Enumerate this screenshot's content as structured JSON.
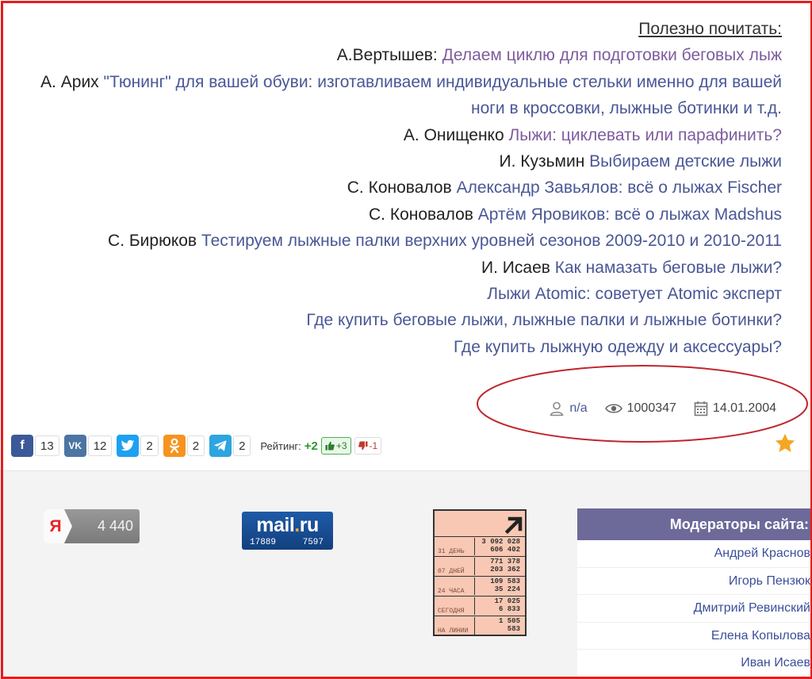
{
  "reading": {
    "header": "Полезно почитать:",
    "items": [
      {
        "author": "А.Вертышев: ",
        "link": "Делаем циклю для подготовки беговых лыж",
        "visited": true
      },
      {
        "author": "А. Арих ",
        "link": "\"Тюнинг\" для вашей обуви: изготавливаем индивидуальные стельки именно для вашей ноги в кроссовки, лыжные ботинки и т.д.",
        "visited": false
      },
      {
        "author": "А. Онищенко ",
        "link": "Лыжи: циклевать или парафинить?",
        "visited": true
      },
      {
        "author": "И. Кузьмин ",
        "link": "Выбираем детские лыжи",
        "visited": false
      },
      {
        "author": "С. Коновалов ",
        "link": "Александр Завьялов: всё о лыжах Fischer",
        "visited": false
      },
      {
        "author": "С. Коновалов ",
        "link": "Артём Яровиков: всё о лыжах Madshus",
        "visited": false
      },
      {
        "author": "С. Бирюков ",
        "link": "Тестируем лыжные палки верхних уровней сезонов 2009-2010 и 2010-2011",
        "visited": false
      },
      {
        "author": "И. Исаев ",
        "link": "Как намазать беговые лыжи?",
        "visited": false
      },
      {
        "author": "",
        "link": "Лыжи Atomic: советует Atomic эксперт",
        "visited": false
      },
      {
        "author": "",
        "link": "Где купить беговые лыжи, лыжные палки и лыжные ботинки?",
        "visited": false
      },
      {
        "author": "",
        "link": "Где купить лыжную одежду и аксессуары?",
        "visited": false
      }
    ]
  },
  "meta": {
    "author": "n/a",
    "views": "1000347",
    "date": "14.01.2004",
    "icons": [
      "user-icon",
      "eye-icon",
      "calendar-icon"
    ]
  },
  "share": {
    "facebook": {
      "label": "f",
      "count": "13",
      "color": "#3b5998"
    },
    "vk": {
      "label": "VK",
      "count": "12",
      "color": "#4c75a3"
    },
    "twitter": {
      "count": "2",
      "color": "#1da1f2"
    },
    "odnoklassniki": {
      "count": "2",
      "color": "#f7931e"
    },
    "telegram": {
      "count": "2",
      "color": "#2ca5e0"
    }
  },
  "rating": {
    "label": "Рейтинг:",
    "total": "+2",
    "up": "+3",
    "down": "-1"
  },
  "counters": {
    "yandex": {
      "logo": "Я",
      "count": "4 440"
    },
    "mailru": {
      "logo_main": "mail",
      "logo_dot": ".",
      "logo_ru": "ru",
      "stat1": "17889",
      "stat2": "7597"
    },
    "liveinternet": {
      "rows": [
        {
          "label": "31 ДЕНЬ",
          "v1": "3 092 028",
          "v2": "606 402"
        },
        {
          "label": "07 ДНЕЙ",
          "v1": "771 378",
          "v2": "203 362"
        },
        {
          "label": "24 ЧАСА",
          "v1": "109 583",
          "v2": "35 224"
        },
        {
          "label": "СЕГОДНЯ",
          "v1": "17 025",
          "v2": "6 833"
        },
        {
          "label": "НА ЛИНИИ",
          "v1": "1 505",
          "v2": "583"
        }
      ]
    }
  },
  "moderators": {
    "title": "Модераторы сайта:",
    "names": [
      "Андрей Краснов",
      "Игорь Пензюк",
      "Дмитрий Ревинский",
      "Елена Копылова",
      "Иван Исаев"
    ]
  },
  "colors": {
    "link": "#4a5796",
    "visited_link": "#7d5c9e",
    "annotation_red": "#c0262c",
    "frame_red": "#e01e1e",
    "moderators_header": "#6d6999",
    "rating_green": "#2e9a2e",
    "star": "#f5a623"
  }
}
